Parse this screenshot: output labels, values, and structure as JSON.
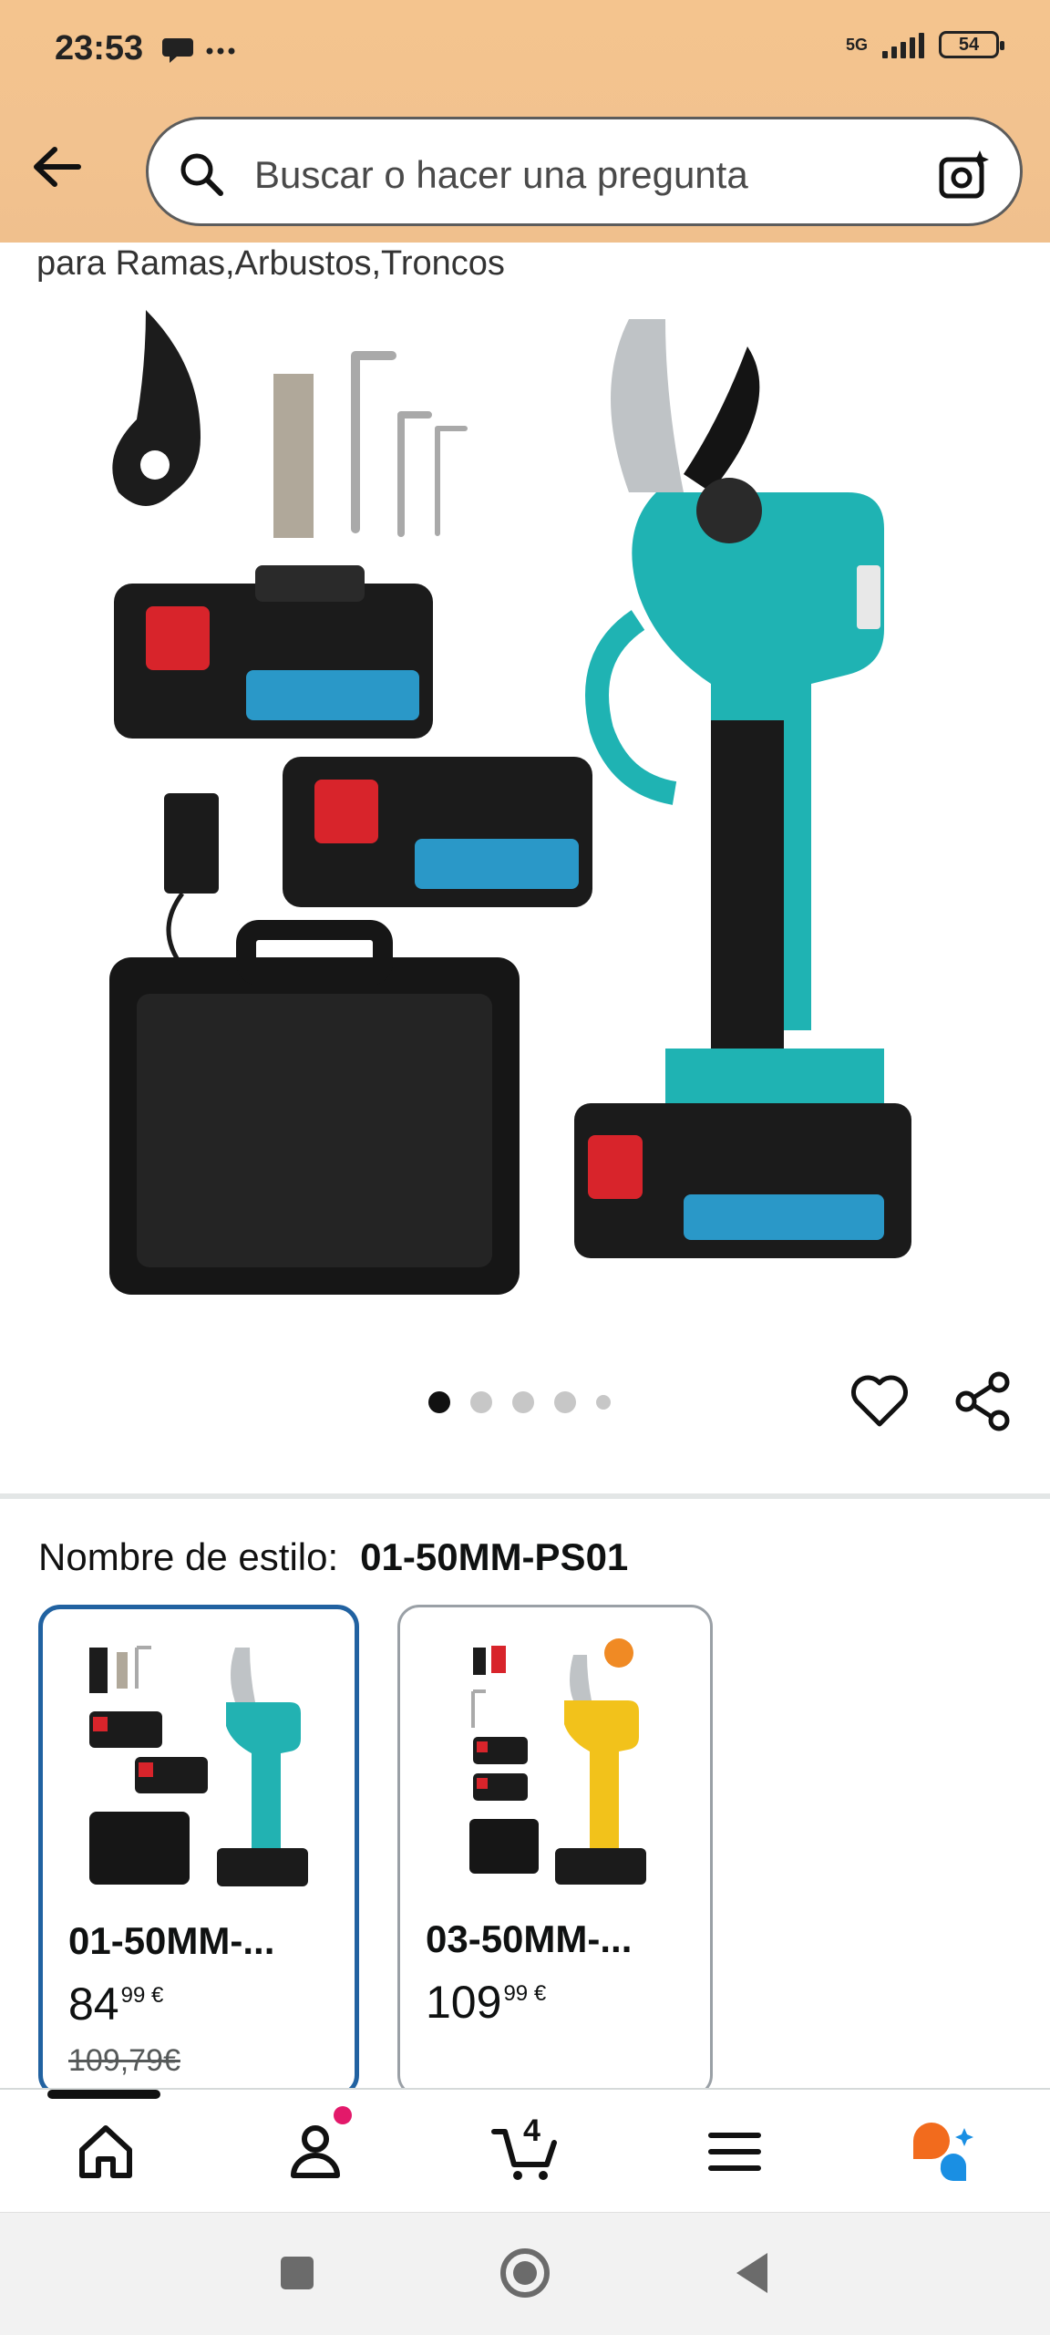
{
  "status_bar": {
    "time": "23:53",
    "left_icons": "•••",
    "network": "5G",
    "battery": "54"
  },
  "search": {
    "placeholder": "Buscar o hacer una pregunta"
  },
  "product": {
    "subtitle": "para Ramas,Arbustos,Troncos",
    "image_dots": 5,
    "active_dot": 0
  },
  "style": {
    "label": "Nombre de estilo:",
    "value": "01-50MM-PS01",
    "options": [
      {
        "name": "01-50MM-...",
        "price_whole": "84",
        "price_fraction": "99",
        "currency": "€",
        "list_price": "109,79€",
        "selected": true,
        "accent": "#22b2b2"
      },
      {
        "name": "03-50MM-...",
        "price_whole": "109",
        "price_fraction": "99",
        "currency": "€",
        "list_price": "",
        "selected": false,
        "accent": "#f2c21b"
      }
    ]
  },
  "bottom_nav": {
    "items": [
      "home-icon",
      "account-icon",
      "cart-icon",
      "menu-icon",
      "rufus-icon"
    ],
    "cart_count": "4"
  },
  "colors": {
    "header": "#f2c28f",
    "selected_border": "#2162a1",
    "teal": "#1fb3b3",
    "notification": "#e3196a"
  }
}
